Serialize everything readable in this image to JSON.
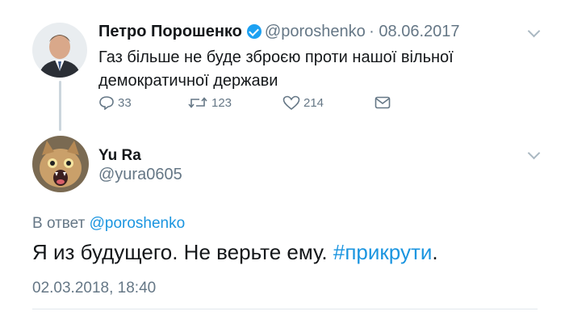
{
  "original_tweet": {
    "author_name": "Петро Порошенко",
    "author_handle": "@poroshenko",
    "date": "· 08.06.2017",
    "text_line1": "Газ більше не буде зброєю проти нашої вільної",
    "text_line2": "демократичної держави",
    "replies": "33",
    "retweets": "123",
    "likes": "214",
    "icons": [
      "reply-icon",
      "retweet-icon",
      "like-icon",
      "message-icon"
    ]
  },
  "reply_tweet": {
    "author_name": "Yu Ra",
    "author_handle": "@yura0605",
    "in_reply_prefix": "В ответ",
    "in_reply_handle": "@poroshenko",
    "text_main": "Я из будущего. Не верьте ему. ",
    "text_hashtag": "#прикрути",
    "text_end": ".",
    "timestamp": "02.03.2018, 18:40"
  },
  "colors": {
    "link": "#1b95e0",
    "muted": "#657786",
    "verified": "#1da1f2"
  }
}
